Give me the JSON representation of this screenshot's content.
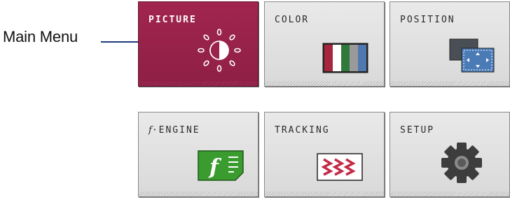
{
  "callout": {
    "label": "Main Menu"
  },
  "menu": {
    "tiles": [
      {
        "label": "PICTURE",
        "icon": "brightness-icon",
        "active": true
      },
      {
        "label": "COLOR",
        "icon": "color-bars-icon",
        "active": false
      },
      {
        "label": "POSITION",
        "icon": "position-icon",
        "active": false
      },
      {
        "label_prefix": "f",
        "label": "·ENGINE",
        "icon": "f-engine-icon",
        "active": false
      },
      {
        "label": "TRACKING",
        "icon": "tracking-icon",
        "active": false
      },
      {
        "label": "SETUP",
        "icon": "gear-icon",
        "active": false
      }
    ]
  },
  "colors": {
    "active_tile": "#9b2249",
    "inactive_tile": "#dedede",
    "callout_line": "#1e3a7a",
    "fengine_green": "#3a9b2f",
    "tracking_red": "#c42a45",
    "position_blue": "#4a7bb7"
  }
}
